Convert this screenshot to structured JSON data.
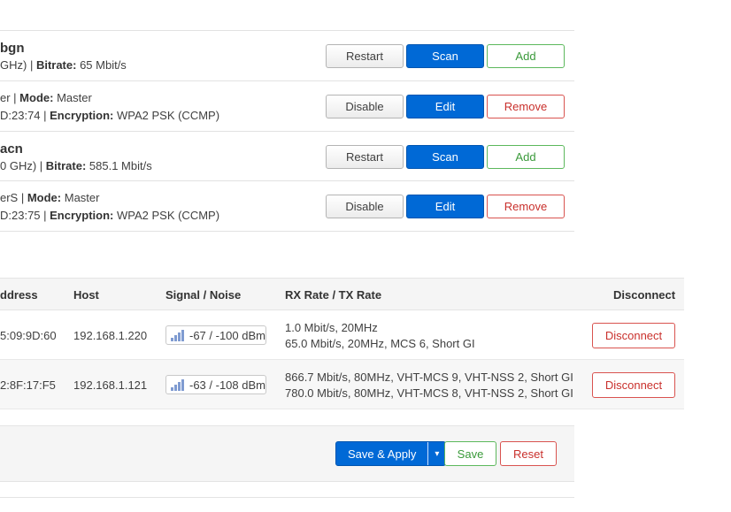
{
  "wireless": [
    {
      "title": "bgn",
      "line_prefix": "GHz) | ",
      "line_label": "Bitrate:",
      "line_value": " 65 Mbit/s",
      "buttons": [
        "Restart",
        "Scan",
        "Add"
      ]
    },
    {
      "l1_prefix": "er | ",
      "l1_label": "Mode:",
      "l1_value": " Master",
      "l2_prefix": "D:23:74 | ",
      "l2_label": "Encryption:",
      "l2_value": " WPA2 PSK (CCMP)",
      "buttons": [
        "Disable",
        "Edit",
        "Remove"
      ]
    },
    {
      "title": "acn",
      "line_prefix": "0 GHz) | ",
      "line_label": "Bitrate:",
      "line_value": " 585.1 Mbit/s",
      "buttons": [
        "Restart",
        "Scan",
        "Add"
      ]
    },
    {
      "l1_prefix": "erS | ",
      "l1_label": "Mode:",
      "l1_value": " Master",
      "l2_prefix": "D:23:75 | ",
      "l2_label": "Encryption:",
      "l2_value": " WPA2 PSK (CCMP)",
      "buttons": [
        "Disable",
        "Edit",
        "Remove"
      ]
    }
  ],
  "stations": {
    "headers": {
      "mac": "ddress",
      "host": "Host",
      "signal": "Signal / Noise",
      "rate": "RX Rate / TX Rate",
      "disconnect": "Disconnect"
    },
    "rows": [
      {
        "mac": "5:09:9D:60",
        "host": "192.168.1.220",
        "signal": "-67 / -100 dBm",
        "rx": "1.0 Mbit/s, 20MHz",
        "tx": "65.0 Mbit/s, 20MHz, MCS 6, Short GI",
        "button": "Disconnect"
      },
      {
        "mac": "2:8F:17:F5",
        "host": "192.168.1.121",
        "signal": "-63 / -108 dBm",
        "rx": "866.7 Mbit/s, 80MHz, VHT-MCS 9, VHT-NSS 2, Short GI",
        "tx": "780.0 Mbit/s, 80MHz, VHT-MCS 8, VHT-NSS 2, Short GI",
        "button": "Disconnect"
      }
    ]
  },
  "actions": {
    "save_apply": "Save & Apply",
    "dropdown_glyph": "▾",
    "save": "Save",
    "reset": "Reset"
  },
  "colors": {
    "primary": "#0069d6",
    "positive": "#5cb85c",
    "negative": "#d9534f",
    "signal_bars": "#7f9bd1"
  }
}
